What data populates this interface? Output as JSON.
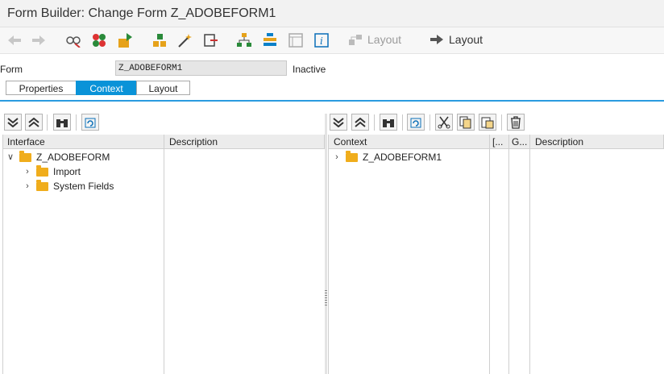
{
  "window": {
    "title": "Form Builder: Change Form Z_ADOBEFORM1"
  },
  "toolbar": {
    "layout_disabled_label": "Layout",
    "layout_label": "Layout",
    "icons": [
      "back-arrow-icon",
      "forward-arrow-icon",
      "display-change-icon",
      "check-icon",
      "activate-icon",
      "object-list-icon",
      "wizard-icon",
      "test-icon",
      "hierarchy-icon",
      "stack-icon",
      "page-icon",
      "info-icon"
    ]
  },
  "form": {
    "label": "Form",
    "value": "Z_ADOBEFORM1",
    "status": "Inactive"
  },
  "tabs": [
    {
      "label": "Properties",
      "active": false
    },
    {
      "label": "Context",
      "active": true
    },
    {
      "label": "Layout",
      "active": false
    }
  ],
  "interface_panel": {
    "columns": [
      "Interface",
      "Description"
    ],
    "tree": [
      {
        "label": "Z_ADOBEFORM",
        "expanded": true,
        "level": 0
      },
      {
        "label": "Import",
        "expanded": false,
        "level": 1
      },
      {
        "label": "System Fields",
        "expanded": false,
        "level": 1
      }
    ]
  },
  "context_panel": {
    "columns": [
      "Context",
      "[...",
      "G...",
      "Description"
    ],
    "tree": [
      {
        "label": "Z_ADOBEFORM1",
        "expanded": false,
        "level": 0
      }
    ]
  },
  "colors": {
    "accent": "#0a93d8",
    "folder": "#f0ad1c"
  }
}
